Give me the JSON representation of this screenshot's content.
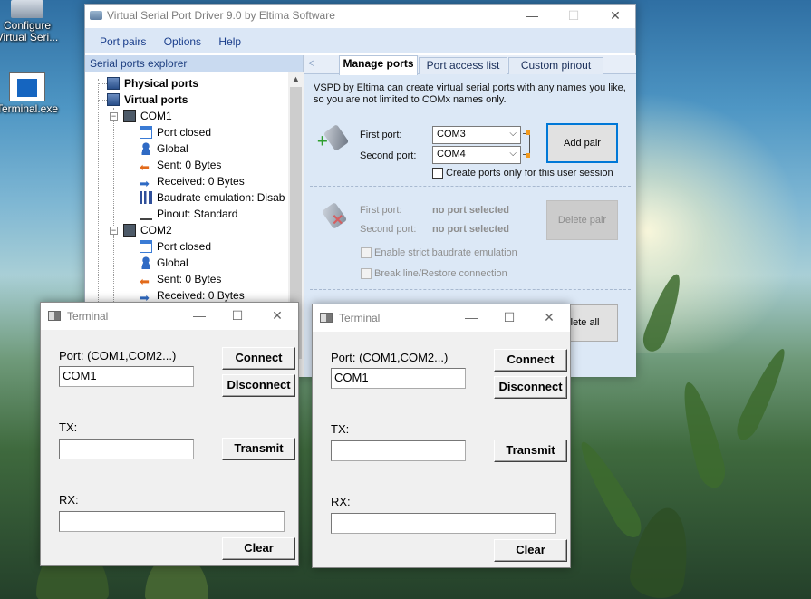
{
  "desktop": {
    "icons": [
      {
        "label": "Configure\nVirtual Seri...",
        "icon": "configure-icon"
      },
      {
        "label": "Terminal.exe",
        "icon": "terminal-exe-icon"
      }
    ]
  },
  "vspd": {
    "title": "Virtual Serial Port Driver 9.0 by Eltima Software",
    "menu": [
      "Port pairs",
      "Options",
      "Help"
    ],
    "explorer_title": "Serial ports explorer",
    "tree": {
      "physical": "Physical ports",
      "virtual": "Virtual ports",
      "com1": {
        "name": "COM1",
        "items": [
          "Port closed",
          "Global",
          "Sent: 0 Bytes",
          "Received: 0 Bytes",
          "Baudrate emulation: Disab",
          "Pinout: Standard"
        ]
      },
      "com2": {
        "name": "COM2",
        "items": [
          "Port closed",
          "Global",
          "Sent: 0 Bytes",
          "Received: 0 Bytes"
        ]
      }
    },
    "tabs": [
      "Manage ports",
      "Port access list",
      "Custom pinout"
    ],
    "description": "VSPD by Eltima can create virtual serial ports with any names you like, so you are not limited to COMx names only.",
    "add": {
      "first_label": "First port:",
      "first_value": "COM3",
      "second_label": "Second port:",
      "second_value": "COM4",
      "button": "Add pair",
      "checkbox": "Create ports only for this user session"
    },
    "delete": {
      "first_label": "First port:",
      "first_value": "no port selected",
      "second_label": "Second port:",
      "second_value": "no port selected",
      "button": "Delete pair",
      "strict": "Enable strict baudrate emulation",
      "break": "Break line/Restore connection"
    },
    "delete_all": "elete all"
  },
  "terminals": [
    {
      "title": "Terminal",
      "port_label": "Port: (COM1,COM2...)",
      "port_value": "COM1",
      "connect": "Connect",
      "disconnect": "Disconnect",
      "tx_label": "TX:",
      "tx_value": "",
      "transmit": "Transmit",
      "rx_label": "RX:",
      "rx_value": "",
      "clear": "Clear"
    },
    {
      "title": "Terminal",
      "port_label": "Port: (COM1,COM2...)",
      "port_value": "COM1",
      "connect": "Connect",
      "disconnect": "Disconnect",
      "tx_label": "TX:",
      "tx_value": "",
      "transmit": "Transmit",
      "rx_label": "RX:",
      "rx_value": "",
      "clear": "Clear"
    }
  ]
}
